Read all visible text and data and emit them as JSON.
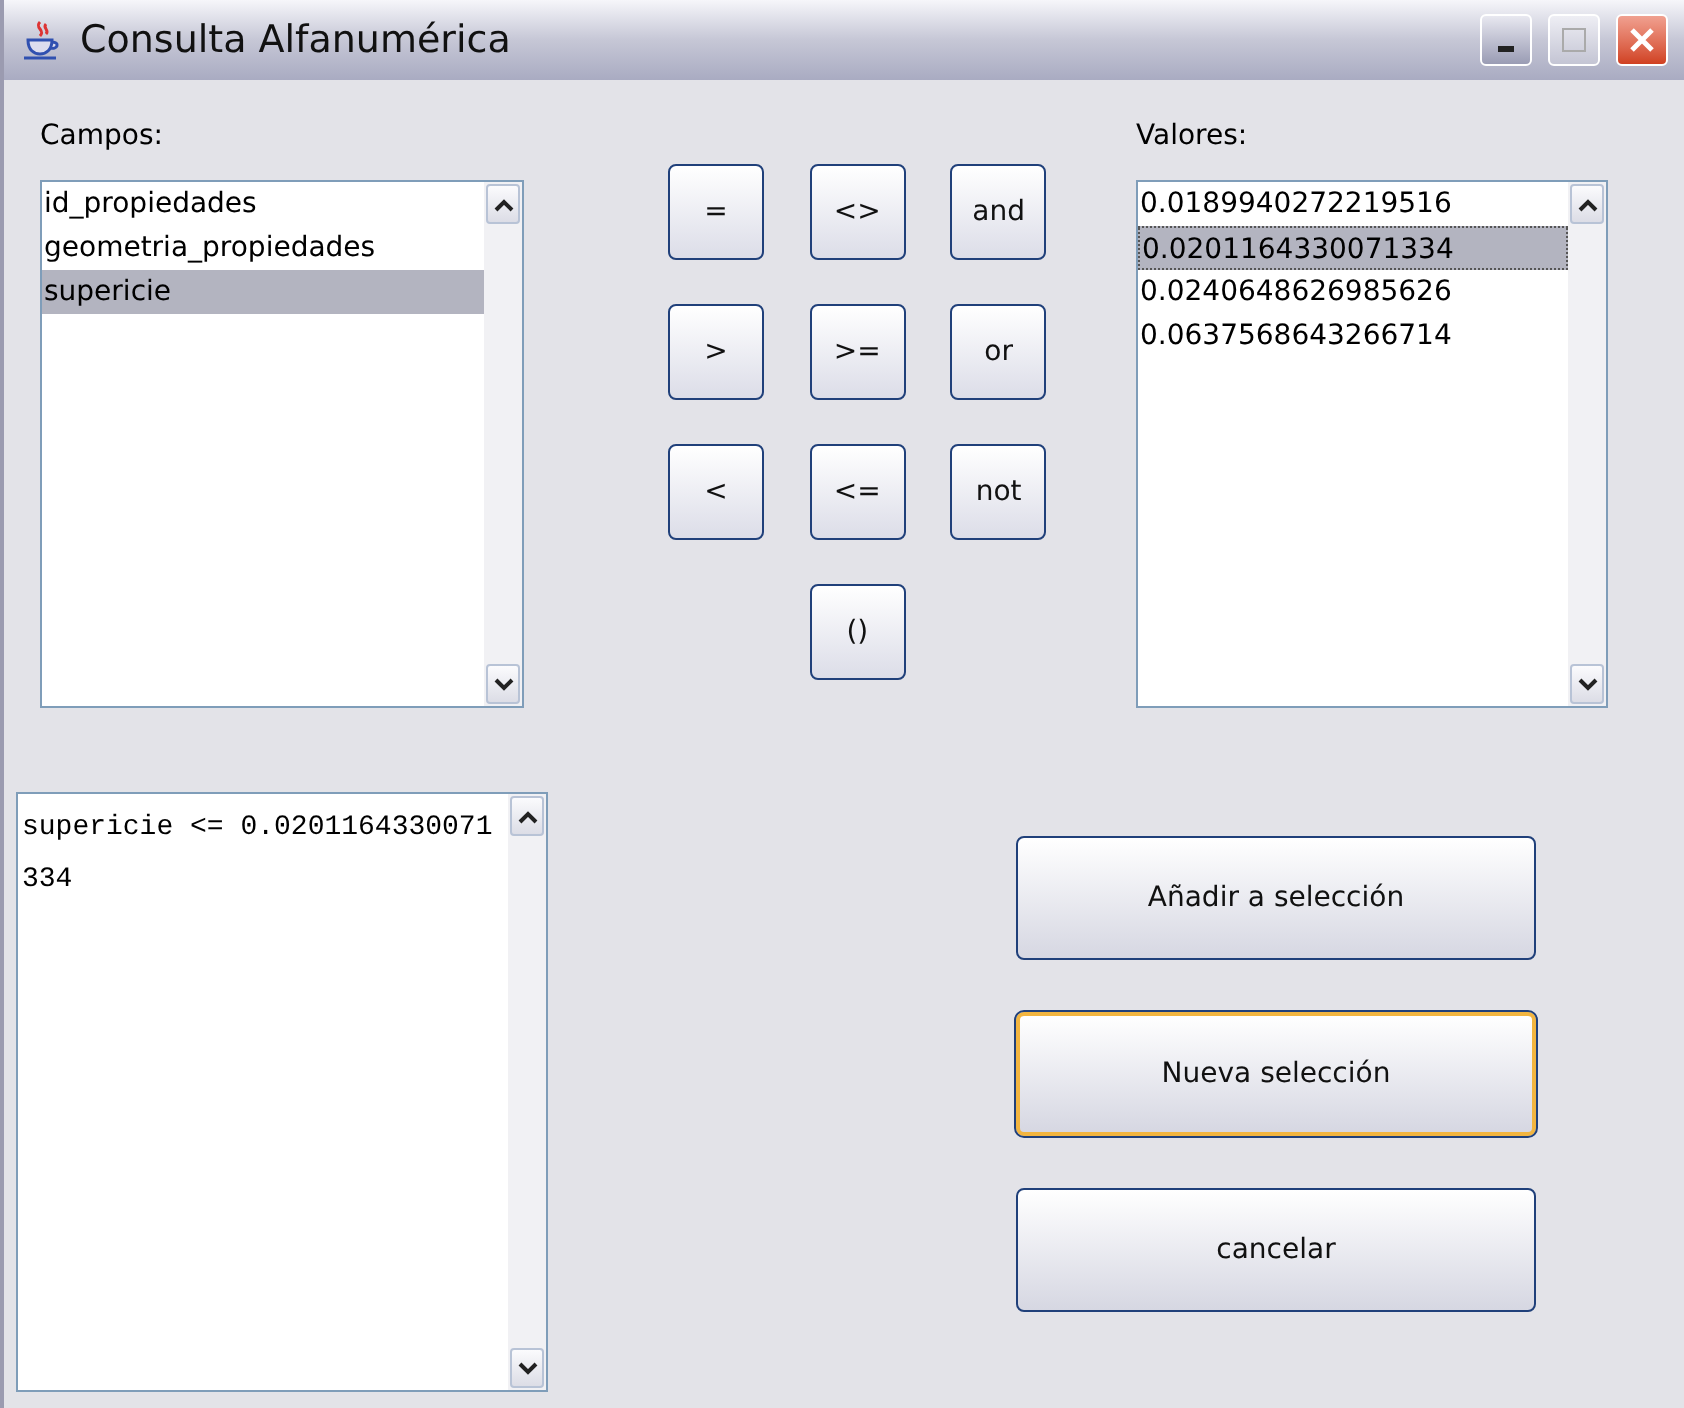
{
  "window": {
    "title": "Consulta Alfanumérica"
  },
  "fields": {
    "label": "Campos:",
    "items": [
      {
        "text": "id_propiedades",
        "selected": false
      },
      {
        "text": "geometria_propiedades",
        "selected": false
      },
      {
        "text": "supericie",
        "selected": true
      }
    ]
  },
  "operators": [
    "=",
    "<>",
    "and",
    ">",
    ">=",
    "or",
    "<",
    "<=",
    "not",
    "()"
  ],
  "values": {
    "label": "Valores:",
    "items": [
      {
        "text": "0.0189940272219516",
        "selected": false
      },
      {
        "text": "0.0201164330071334",
        "selected": true
      },
      {
        "text": "0.0240648626985626",
        "selected": false
      },
      {
        "text": "0.0637568643266714",
        "selected": false
      }
    ]
  },
  "query": {
    "value": "supericie <= 0.0201164330071334"
  },
  "actions": [
    {
      "label": "Añadir a selección",
      "focused": false
    },
    {
      "label": "Nueva selección",
      "focused": true
    },
    {
      "label": "cancelar",
      "focused": false
    }
  ]
}
